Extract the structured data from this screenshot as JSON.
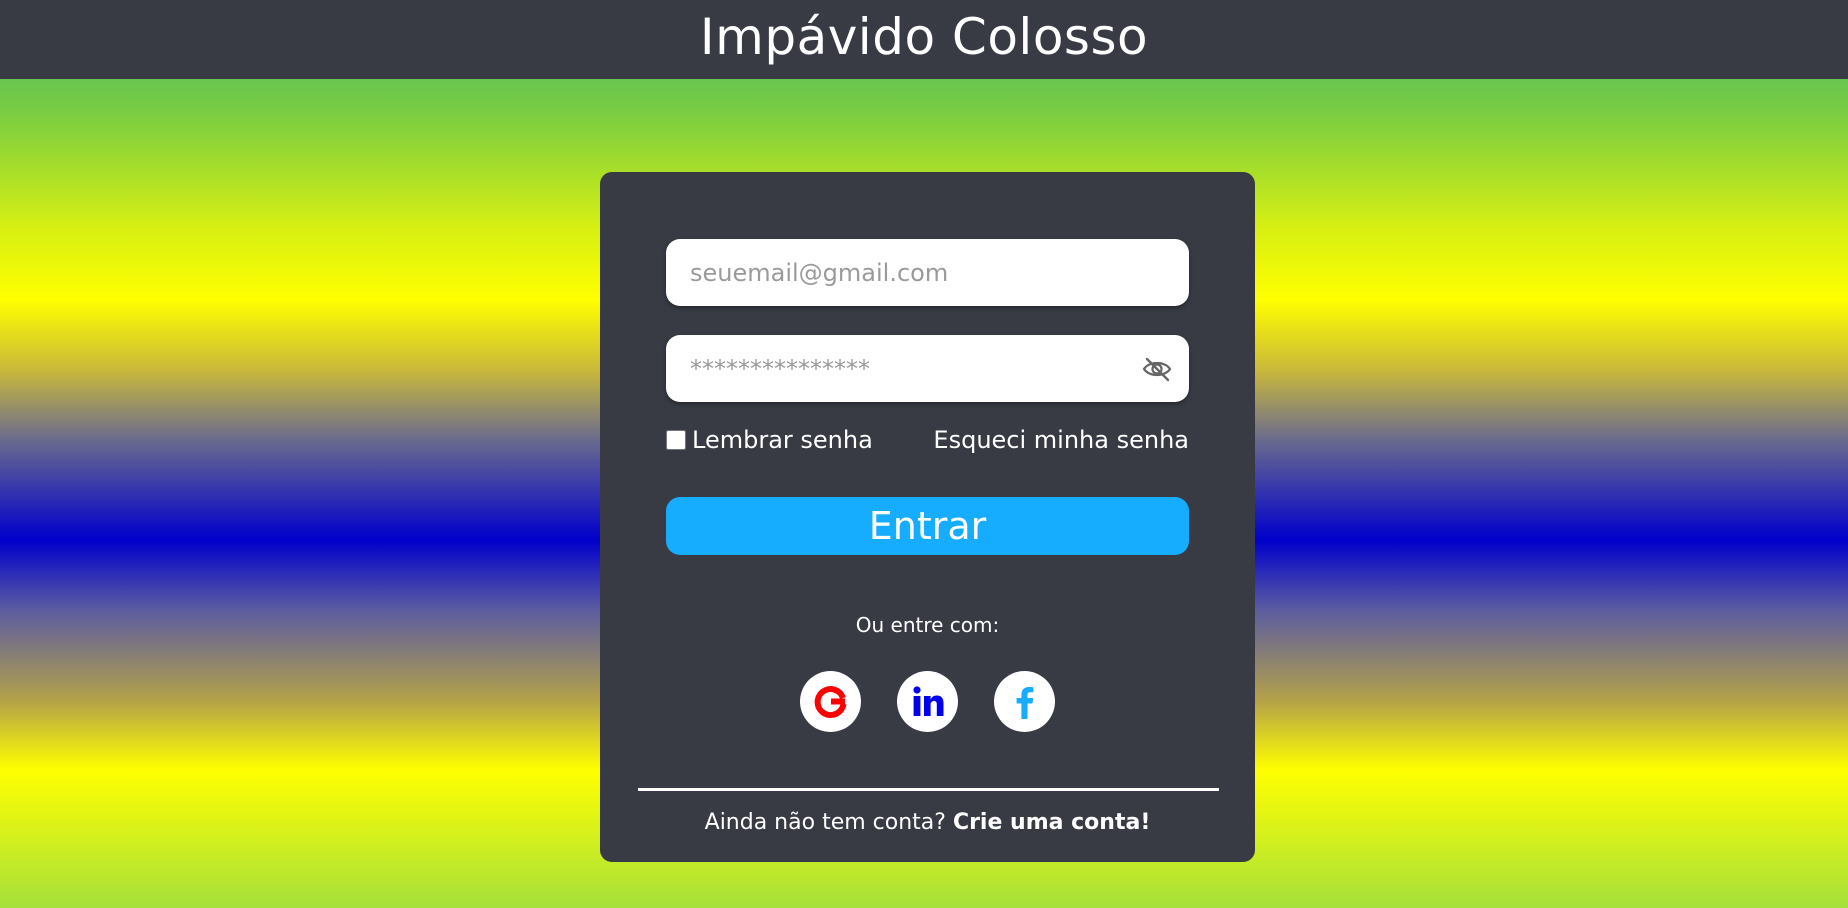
{
  "header": {
    "title": "Impávido Colosso"
  },
  "login": {
    "email_placeholder": "seuemail@gmail.com",
    "email_value": "",
    "password_placeholder": "***************",
    "password_value": "",
    "password_toggle_icon": "eye-slash-icon",
    "remember_label": "Lembrar senha",
    "remember_checked": false,
    "forgot_label": "Esqueci minha senha",
    "submit_label": "Entrar",
    "alt_login_text": "Ou entre com:",
    "social": [
      {
        "name": "google",
        "icon": "google-icon",
        "color": "#ff0000"
      },
      {
        "name": "linkedin",
        "icon": "linkedin-icon",
        "color": "#0000ee"
      },
      {
        "name": "facebook",
        "icon": "facebook-icon",
        "color": "#16acff"
      }
    ],
    "signup_prompt": "Ainda não tem conta?",
    "signup_link": "Crie uma conta!"
  },
  "colors": {
    "header_bg": "#383b44",
    "card_bg": "#383b44",
    "button_bg": "#16acff",
    "text": "#ffffff"
  }
}
